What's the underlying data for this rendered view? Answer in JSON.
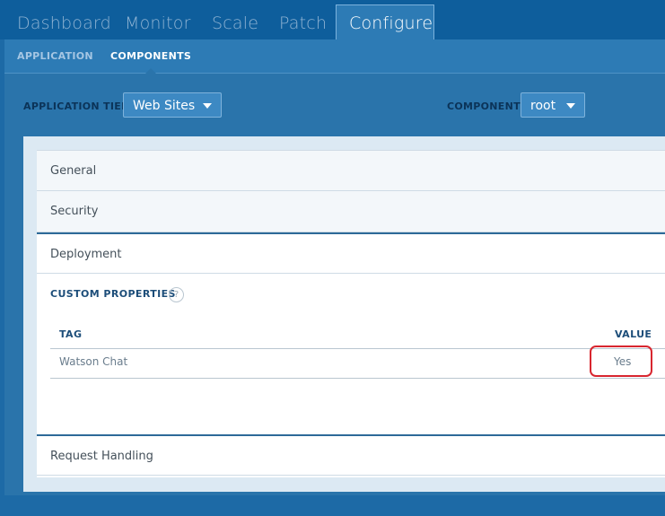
{
  "top_nav": {
    "tabs": [
      {
        "label": "Dashboard"
      },
      {
        "label": "Monitor"
      },
      {
        "label": "Scale"
      },
      {
        "label": "Patch"
      },
      {
        "label": "Configure"
      }
    ],
    "active": "Configure"
  },
  "sub_nav": {
    "tabs": [
      {
        "label": "APPLICATION"
      },
      {
        "label": "COMPONENTS"
      }
    ],
    "active": "COMPONENTS"
  },
  "filters": {
    "application_tier": {
      "label": "APPLICATION TIER",
      "value": "Web Sites"
    },
    "component": {
      "label": "COMPONENT",
      "value": "root"
    }
  },
  "sections": {
    "general": "General",
    "security": "Security",
    "deployment": "Deployment",
    "request_handling": "Request Handling"
  },
  "custom_properties": {
    "title": "CUSTOM PROPERTIES",
    "help": "?",
    "columns": {
      "tag": "TAG",
      "value": "VALUE"
    },
    "rows": [
      {
        "tag": "Watson Chat",
        "value": "Yes"
      }
    ]
  },
  "colors": {
    "background": "#1d6aa6",
    "top_nav": "#0e5e9c",
    "active_tab": "#2d7bb5",
    "highlight": "#d8262f"
  }
}
